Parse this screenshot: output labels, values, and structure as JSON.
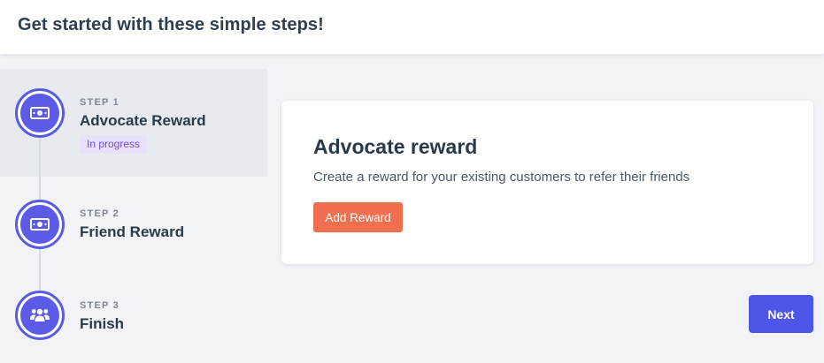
{
  "header": {
    "title": "Get started with these simple steps!"
  },
  "steps": [
    {
      "eyebrow": "STEP 1",
      "title": "Advocate Reward",
      "badge": "In progress",
      "icon": "money-bill-icon"
    },
    {
      "eyebrow": "STEP 2",
      "title": "Friend Reward",
      "icon": "money-bill-icon"
    },
    {
      "eyebrow": "STEP 3",
      "title": "Finish",
      "icon": "users-icon"
    }
  ],
  "card": {
    "title": "Advocate reward",
    "description": "Create a reward for your existing customers to refer their friends",
    "button_label": "Add Reward"
  },
  "footer": {
    "next_label": "Next"
  },
  "colors": {
    "accent": "#5b5be8",
    "cta": "#f06f4f",
    "next": "#4f55e6",
    "badge_bg": "#e9e1fb",
    "badge_text": "#6a4fd6"
  }
}
